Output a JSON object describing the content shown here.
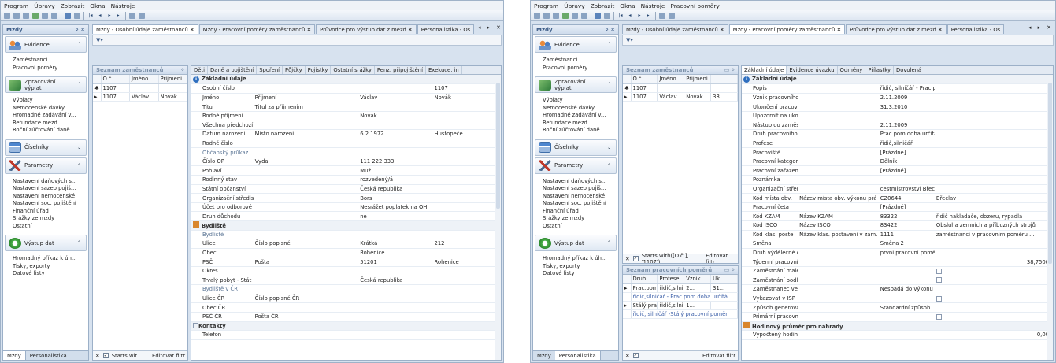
{
  "left": {
    "menu": [
      "Program",
      "Úpravy",
      "Zobrazit",
      "Okna",
      "Nástroje"
    ],
    "nav": {
      "title": "Mzdy",
      "sections": [
        {
          "label": "Evidence",
          "icon": "people-icon",
          "items": [
            "Zaměstnanci",
            "Pracovní poměry"
          ]
        },
        {
          "label": "Zpracování výplat",
          "icon": "calculator-icon",
          "items": [
            "Výplaty",
            "Nemocenské dávky",
            "Hromadné zadávání v...",
            "Refundace mezd",
            "Roční zúčtování daně"
          ]
        },
        {
          "label": "Číselníky",
          "icon": "table-icon",
          "items": []
        },
        {
          "label": "Parametry",
          "icon": "tools-icon",
          "items": [
            "Nastavení daňových s...",
            "Nastavení sazeb pojiš...",
            "Nastavení nemocenské",
            "Nastavení soc. pojištění",
            "Finanční úřad",
            "Srážky ze mzdy",
            "Ostatní"
          ]
        },
        {
          "label": "Výstup dat",
          "icon": "output-icon",
          "items": [
            "Hromadný příkaz k úh...",
            "Tisky, exporty",
            "Datové listy"
          ]
        }
      ],
      "bottom_tabs": [
        "Mzdy",
        "Personalistika"
      ]
    },
    "tabs": [
      "Mzdy - Osobní údaje zaměstnanců",
      "Mzdy - Pracovní poměry zaměstnanců",
      "Průvodce pro výstup dat z mezd",
      "Personalistika - Os"
    ],
    "list": {
      "title": "Seznam zaměstnanců",
      "headers": [
        "O.č.",
        "Jméno",
        "Příjmení"
      ],
      "rows": [
        [
          "1107",
          "",
          ""
        ],
        [
          "1107",
          "Václav",
          "Novák"
        ]
      ],
      "footer": "Starts wit...",
      "footer_edit": "Editovat filtr"
    },
    "detail": {
      "tabs": [
        "Děti",
        "Daně a pojištění",
        "Spoření",
        "Půjčky",
        "Pojistky",
        "Ostatní srážky",
        "Penz. připojištění",
        "Exekuce, in"
      ],
      "rows": [
        {
          "t": "cat",
          "a": "Základní údaje",
          "icon": "info"
        },
        {
          "a": "Osobní číslo",
          "b": "",
          "c": "",
          "d": "1107"
        },
        {
          "a": "Jméno",
          "b": "Příjmení",
          "c": "Václav",
          "d": "Novák"
        },
        {
          "a": "Titul",
          "b": "Titul za příjmením",
          "c": "",
          "d": ""
        },
        {
          "a": "Rodné příjmení",
          "b": "",
          "c": "Novák",
          "d": ""
        },
        {
          "a": "Všechna předchozí příjmení",
          "b": "",
          "c": "",
          "d": ""
        },
        {
          "a": "Datum narození",
          "b": "Místo narození",
          "c": "6.2.1972",
          "d": "Hustopeče"
        },
        {
          "a": "Rodné číslo",
          "b": "",
          "c": "",
          "d": ""
        },
        {
          "t": "sub",
          "a": "Občanský průkaz",
          "b": "",
          "c": "",
          "d": ""
        },
        {
          "a": "Číslo OP",
          "b": "Vydal",
          "c": "111 222 333",
          "d": ""
        },
        {
          "a": "Pohlaví",
          "b": "",
          "c": "Muž",
          "d": ""
        },
        {
          "a": "Rodinný stav",
          "b": "",
          "c": "rozvedený/á",
          "d": ""
        },
        {
          "a": "Státní občanství",
          "b": "",
          "c": "Česká republika",
          "d": ""
        },
        {
          "a": "Organizační středisko k výplatě",
          "b": "",
          "c": "Bors",
          "d": ""
        },
        {
          "a": "Účet pro odborové hnutí",
          "b": "",
          "c": "Nesrážet poplatek na OH",
          "d": ""
        },
        {
          "a": "Druh důchodu",
          "b": "",
          "c": "ne",
          "d": ""
        },
        {
          "t": "cat",
          "a": "Bydliště",
          "icon": "home"
        },
        {
          "t": "sub",
          "a": "Bydliště",
          "b": "",
          "c": "",
          "d": ""
        },
        {
          "a": "Ulice",
          "b": "Číslo popisné",
          "c": "Krátká",
          "d": "212"
        },
        {
          "a": "Obec",
          "b": "",
          "c": "Rohenice",
          "d": ""
        },
        {
          "a": "PSČ",
          "b": "Pošta",
          "c": "51201",
          "d": "Rohenice"
        },
        {
          "a": "Okres",
          "b": "",
          "c": "",
          "d": ""
        },
        {
          "a": "Trvalý pobyt - Stát",
          "b": "",
          "c": "Česká republika",
          "d": ""
        },
        {
          "t": "sub",
          "a": "Bydliště v ČR",
          "b": "",
          "c": "",
          "d": ""
        },
        {
          "a": "Ulice ČR",
          "b": "Číslo popisné ČR",
          "c": "",
          "d": ""
        },
        {
          "a": "Obec ČR",
          "b": "",
          "c": "",
          "d": ""
        },
        {
          "a": "PSČ ČR",
          "b": "Pošta ČR",
          "c": "",
          "d": ""
        },
        {
          "t": "cat",
          "a": "Kontakty",
          "icon": "box"
        },
        {
          "a": "Telefon",
          "b": "",
          "c": "",
          "d": ""
        }
      ]
    }
  },
  "right": {
    "menu": [
      "Program",
      "Úpravy",
      "Zobrazit",
      "Okna",
      "Nástroje",
      "Pracovní poměry"
    ],
    "nav": {
      "title": "Mzdy",
      "bottom_tabs": [
        "Mzdy",
        "Personalistika"
      ]
    },
    "tabs": [
      "Mzdy - Osobní údaje zaměstnanců",
      "Mzdy - Pracovní poměry zaměstnanců",
      "Průvodce pro výstup dat z mezd",
      "Personalistika - Os"
    ],
    "list": {
      "title": "Seznam zaměstnanců",
      "headers": [
        "O.č.",
        "Jméno",
        "Příjmení",
        "..."
      ],
      "rows": [
        [
          "1107",
          "",
          "",
          ""
        ],
        [
          "1107",
          "Václav",
          "Novák",
          "38"
        ]
      ],
      "footer": "Starts with([O.č.], '1107')",
      "footer_edit": "Editovat filtr"
    },
    "list2": {
      "title": "Seznam pracovních poměrů",
      "headers": [
        "Druh",
        "Profese",
        "Vznik",
        "Uk..."
      ],
      "rows": [
        {
          "a": "Prac.pom.d...",
          "b": "řidič,silničář",
          "c": "2...",
          "d": "31..."
        },
        {
          "link": "řidič,silničář - Prac.pom.doba určitá"
        },
        {
          "a": "Stálý pracov...",
          "b": "řidič,silničář",
          "c": "1...",
          "d": ""
        },
        {
          "link": "řidič, silničář -Stálý pracovní poměr"
        }
      ],
      "footer_edit": "Editovat filtr"
    },
    "detail": {
      "tabs": [
        "Základní údaje",
        "Evidence úvazku",
        "Odměny",
        "Přílastky",
        "Dovolená"
      ],
      "rows": [
        {
          "t": "cat",
          "a": "Základní údaje",
          "icon": "info"
        },
        {
          "a": "Popis",
          "c": "řidič, silničář - Prac.pom.doba určitá",
          "d": ""
        },
        {
          "a": "Vznik pracovního poměru",
          "c": "2.11.2009",
          "d": ""
        },
        {
          "a": "Ukončení pracovního poměru",
          "c": "31.3.2010",
          "d": ""
        },
        {
          "a": "Upozornit na ukončení pracovního poměru",
          "c": "",
          "d": ""
        },
        {
          "a": "Nástup do zaměstnání",
          "c": "2.11.2009",
          "d": ""
        },
        {
          "a": "Druh pracovního poměru",
          "c": "Prac.pom.doba určitá",
          "d": ""
        },
        {
          "a": "Profese",
          "c": "řidič,silničář",
          "d": ""
        },
        {
          "a": "Pracoviště",
          "c": "[Prázdné]",
          "d": ""
        },
        {
          "a": "Pracovní kategorie",
          "c": "Dělník",
          "d": ""
        },
        {
          "a": "Pracovní zařazení",
          "c": "[Prázdné]",
          "d": ""
        },
        {
          "a": "Poznámka",
          "c": "",
          "d": ""
        },
        {
          "a": "Organizační středisko",
          "c": "cestmistrovství Břeclav",
          "d": ""
        },
        {
          "a": "Kód místa obv.",
          "b": "Název místa obv. výkonu prá",
          "c": "CZ0644",
          "d": "Břeclav"
        },
        {
          "a": "Pracovní četa",
          "c": "[Prázdné]",
          "d": ""
        },
        {
          "a": "Kód KZAM",
          "b": "Název KZAM",
          "c": "83322",
          "d": "řidič nakladače, dozeru, rypadla"
        },
        {
          "a": "Kód ISCO",
          "b": "Název ISCO",
          "c": "83422",
          "d": "Obsluha zemních a příbuzných strojů"
        },
        {
          "a": "Kód klas. poste",
          "b": "Název klas. postavení v zam.",
          "c": "1111",
          "d": "zaměstnanci v pracovním poměru ..."
        },
        {
          "a": "Směna",
          "c": "Směna 2",
          "d": ""
        },
        {
          "a": "Druh výdělečné činnosti",
          "c": "první pracovní poměr",
          "d": ""
        },
        {
          "a": "Týdenní pracovní úvazek",
          "c": "",
          "d": "38,7500"
        },
        {
          "a": "Zaměstnání malého rozsahu",
          "c": "",
          "d": "",
          "box": true
        },
        {
          "a": "Zaměstnání podle jiného zákona než podle zá",
          "c": "",
          "d": "",
          "box": true
        },
        {
          "a": "Zaměstnanec ve státní správě",
          "c": "Nespadá do výkonu funkce ve státní správě",
          "d": ""
        },
        {
          "a": "Vykazovat v ISP",
          "c": "",
          "d": "",
          "box": true
        },
        {
          "a": "Způsob generování výplaty z deníku",
          "c": "Standardní způsob",
          "d": ""
        },
        {
          "a": "Primární pracovní poměr",
          "c": "",
          "d": "",
          "box": true
        },
        {
          "t": "cat",
          "a": "Hodinový průměr pro náhrady",
          "icon": "hour"
        },
        {
          "a": "Vypočtený hodinový průměr",
          "c": "",
          "d": "0,00"
        }
      ]
    }
  }
}
